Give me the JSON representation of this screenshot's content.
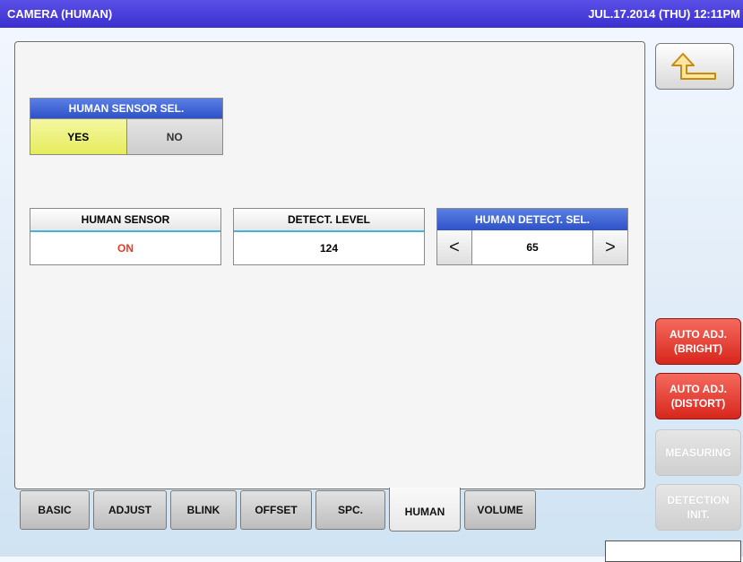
{
  "header": {
    "title": "CAMERA (HUMAN)",
    "datetime": "JUL.17.2014 (THU)  12:11PM",
    "bar_color": "#3b2fcf"
  },
  "human_sensor_sel": {
    "label": "HUMAN SENSOR SEL.",
    "options": {
      "yes": "YES",
      "no": "NO"
    },
    "selected": "YES"
  },
  "human_sensor": {
    "label": "HUMAN SENSOR",
    "value": "ON"
  },
  "detect_level": {
    "label": "DETECT. LEVEL",
    "value": "124"
  },
  "human_detect_sel": {
    "label": "HUMAN DETECT. SEL.",
    "value": "65",
    "left_arrow": "<",
    "right_arrow": ">"
  },
  "tabs": [
    {
      "label": "BASIC"
    },
    {
      "label": "ADJUST"
    },
    {
      "label": "BLINK"
    },
    {
      "label": "OFFSET"
    },
    {
      "label": "SPC."
    },
    {
      "label": "HUMAN",
      "active": true
    },
    {
      "label": "VOLUME"
    }
  ],
  "side": {
    "back_icon": "return-arrow-icon",
    "auto_adj_bright": "AUTO ADJ.\n(BRIGHT)",
    "auto_adj_distort": "AUTO ADJ.\n(DISTORT)",
    "measuring": "MEASURING",
    "detection_init": "DETECTION\nINIT."
  },
  "colors": {
    "accent_blue": "#2e52c8",
    "yes_yellow": "#e6ec5c",
    "alert_red": "#d8261c",
    "value_red": "#e53a2a"
  }
}
